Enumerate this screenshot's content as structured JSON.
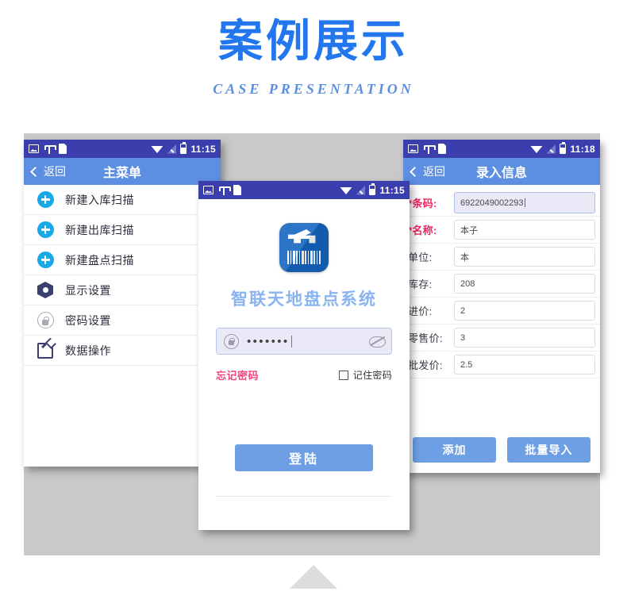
{
  "header": {
    "title": "案例展示",
    "subtitle": "CASE  PRESENTATION"
  },
  "colors": {
    "title_blue": "#2277ee",
    "subtitle_blue": "#5b8fe0",
    "statusbar": "#3b3fae",
    "toolbar": "#5c8ee2",
    "button_blue": "#6e9fe4",
    "accent_pink": "#f0245f",
    "plus_cyan": "#18a9e8",
    "backdrop_gray": "#c9c9c9"
  },
  "phone_left": {
    "statusbar": {
      "icons": [
        "image-icon",
        "usb-icon",
        "document-icon"
      ],
      "right_icons": [
        "wifi-icon",
        "signal-icon",
        "battery-icon"
      ],
      "time": "11:15"
    },
    "toolbar": {
      "back_label": "返回",
      "title": "主菜单"
    },
    "menu_items": [
      {
        "icon": "plus-circle-icon",
        "label": "新建入库扫描"
      },
      {
        "icon": "plus-circle-icon",
        "label": "新建出库扫描"
      },
      {
        "icon": "plus-circle-icon",
        "label": "新建盘点扫描"
      },
      {
        "icon": "gear-icon",
        "label": "显示设置"
      },
      {
        "icon": "lock-icon",
        "label": "密码设置"
      },
      {
        "icon": "edit-icon",
        "label": "数据操作"
      }
    ]
  },
  "phone_center": {
    "statusbar": {
      "icons": [
        "image-icon",
        "usb-icon",
        "document-icon"
      ],
      "right_icons": [
        "wifi-icon",
        "signal-icon",
        "battery-icon"
      ],
      "time": "11:15"
    },
    "app_icon": "barcode-app-icon",
    "app_name": "智联天地盘点系统",
    "password": {
      "icon": "lock-icon",
      "value": "•••••••",
      "toggle_icon": "eye-slash-icon"
    },
    "forgot_label": "忘记密码",
    "remember_label": "记住密码",
    "remember_checked": false,
    "login_label": "登陆"
  },
  "phone_right": {
    "statusbar": {
      "icons": [
        "image-icon",
        "usb-icon",
        "document-icon"
      ],
      "right_icons": [
        "wifi-icon",
        "signal-icon",
        "battery-icon"
      ],
      "time": "11:18"
    },
    "toolbar": {
      "back_label": "返回",
      "title": "录入信息"
    },
    "fields": [
      {
        "label": "*条码:",
        "value": "6922049002293",
        "required": true,
        "active": true
      },
      {
        "label": "*名称:",
        "value": "本子",
        "required": true,
        "active": false
      },
      {
        "label": "单位:",
        "value": "本",
        "required": false,
        "active": false
      },
      {
        "label": "库存:",
        "value": "208",
        "required": false,
        "active": false
      },
      {
        "label": "进价:",
        "value": "2",
        "required": false,
        "active": false
      },
      {
        "label": "零售价:",
        "value": "3",
        "required": false,
        "active": false
      },
      {
        "label": "批发价:",
        "value": "2.5",
        "required": false,
        "active": false
      }
    ],
    "buttons": [
      {
        "label": "添加"
      },
      {
        "label": "批量导入"
      }
    ]
  },
  "footer": {
    "arrow_icon": "triangle-up-icon"
  }
}
